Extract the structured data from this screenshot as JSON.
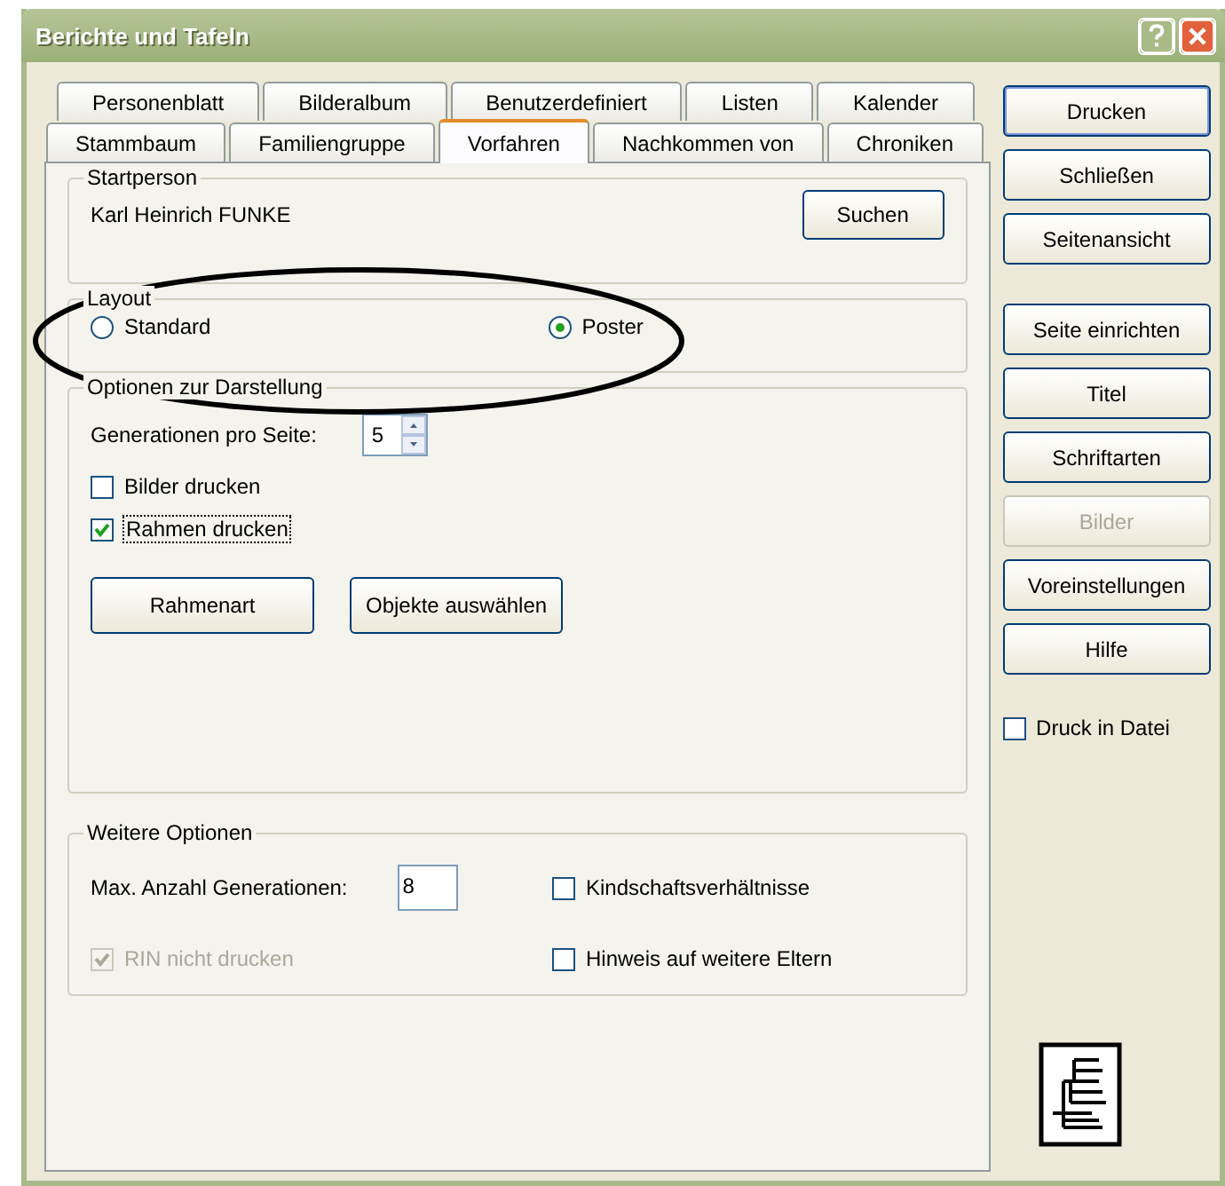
{
  "window": {
    "title": "Berichte und Tafeln"
  },
  "tab_rows": [
    [
      {
        "label": "Personenblatt",
        "selected": false
      },
      {
        "label": "Bilderalbum",
        "selected": false
      },
      {
        "label": "Benutzerdefiniert",
        "selected": false
      },
      {
        "label": "Listen",
        "selected": false
      },
      {
        "label": "Kalender",
        "selected": false
      }
    ],
    [
      {
        "label": "Stammbaum",
        "selected": false
      },
      {
        "label": "Familiengruppe",
        "selected": false
      },
      {
        "label": "Vorfahren",
        "selected": true
      },
      {
        "label": "Nachkommen von",
        "selected": false
      },
      {
        "label": "Chroniken",
        "selected": false
      }
    ]
  ],
  "start_person": {
    "label": "Startperson",
    "value": "Karl Heinrich FUNKE",
    "button": "Suchen"
  },
  "layout": {
    "label": "Layout",
    "options": [
      {
        "label": "Standard",
        "selected": false
      },
      {
        "label": "Poster",
        "selected": true
      }
    ]
  },
  "display_options": {
    "label": "Optionen zur Darstellung",
    "generations": {
      "label": "Generationen pro Seite:",
      "value": "5"
    },
    "checkboxes": [
      {
        "label": "Bilder drucken",
        "checked": false,
        "focused": false
      },
      {
        "label": "Rahmen drucken",
        "checked": true,
        "focused": true
      }
    ],
    "buttons": [
      "Rahmenart",
      "Objekte auswählen"
    ]
  },
  "more_options": {
    "label": "Weitere Optionen",
    "max_generations": {
      "label": "Max. Anzahl Generationen:",
      "value": "8"
    },
    "checkboxes": [
      {
        "label": "Kindschaftsverhältnisse",
        "checked": false,
        "disabled": false
      },
      {
        "label": "RIN nicht drucken",
        "checked": true,
        "disabled": true
      },
      {
        "label": "Hinweis auf weitere Eltern",
        "checked": false,
        "disabled": false
      }
    ]
  },
  "side_button_groups": [
    [
      {
        "label": "Drucken",
        "default": true,
        "disabled": false
      },
      {
        "label": "Schließen",
        "default": false,
        "disabled": false
      },
      {
        "label": "Seitenansicht",
        "default": false,
        "disabled": false
      }
    ],
    [
      {
        "label": "Seite einrichten",
        "default": false,
        "disabled": false
      },
      {
        "label": "Titel",
        "default": false,
        "disabled": false
      },
      {
        "label": "Schriftarten",
        "default": false,
        "disabled": false
      },
      {
        "label": "Bilder",
        "default": false,
        "disabled": true
      },
      {
        "label": "Voreinstellungen",
        "default": false,
        "disabled": false
      },
      {
        "label": "Hilfe",
        "default": false,
        "disabled": false
      }
    ]
  ],
  "print_to_file": {
    "label": "Druck in Datei",
    "checked": false
  }
}
